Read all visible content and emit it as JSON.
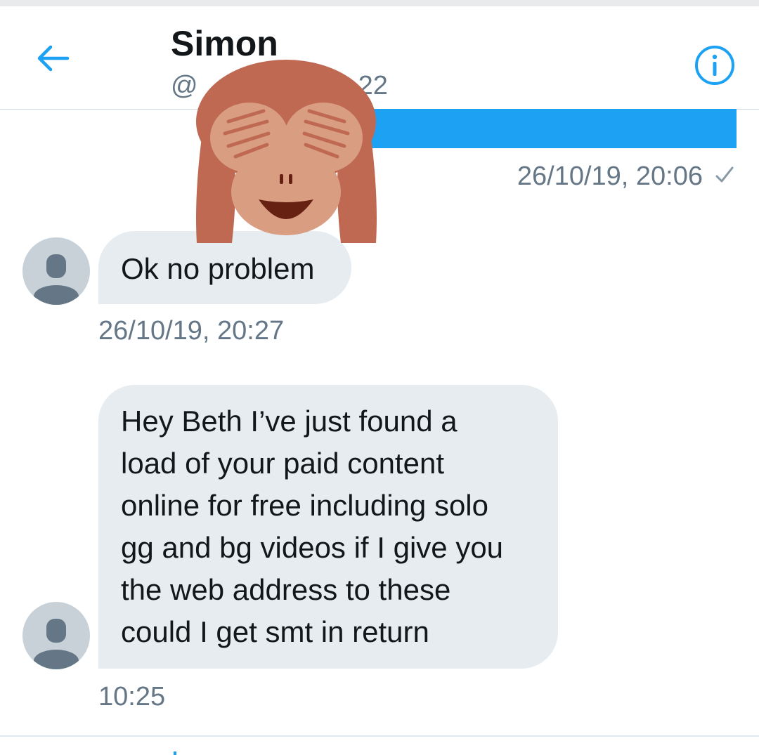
{
  "header": {
    "title": "Simon",
    "handle_visible": "@",
    "handle_tail": "22"
  },
  "messages": [
    {
      "direction": "outgoing",
      "timestamp": "26/10/19, 20:06",
      "status": "sent-check"
    },
    {
      "direction": "incoming",
      "text": "Ok no problem",
      "timestamp": "26/10/19, 20:27"
    },
    {
      "direction": "incoming",
      "text": "Hey Beth I’ve just found a\nload of your paid content\nonline for free including solo\ngg and bg videos if I give you\nthe web address to these\ncould I get smt in return",
      "timestamp": "10:25"
    }
  ],
  "icons": {
    "back": "arrow-left-icon",
    "info": "info-icon",
    "overlay": "see-no-evil-monkey-emoji"
  },
  "colors": {
    "accent": "#1da1f2",
    "incoming_bubble": "#e6ecf0",
    "muted_text": "#657786"
  }
}
